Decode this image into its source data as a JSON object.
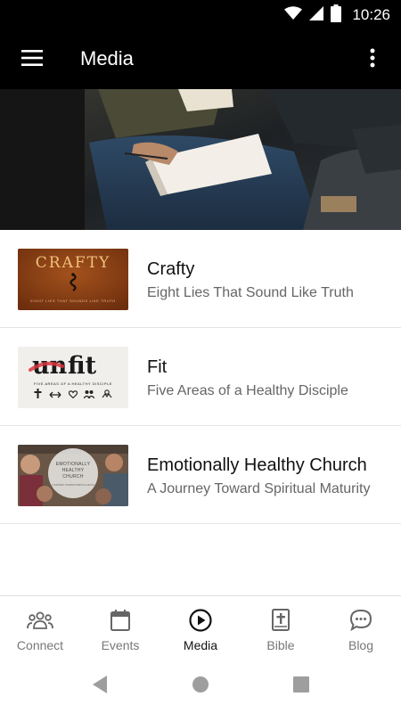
{
  "status_bar": {
    "time": "10:26",
    "icons": [
      "wifi-icon",
      "cellular-signal-icon",
      "battery-icon"
    ]
  },
  "app_bar": {
    "title": "Media",
    "left_icon": "menu-icon",
    "right_icon": "more-vert-icon"
  },
  "hero": {
    "image": "people-with-notebooks-photo"
  },
  "media_list": {
    "items": [
      {
        "title": "Crafty",
        "subtitle": "Eight Lies That Sound Like Truth",
        "thumb": {
          "word": "CRAFTY",
          "tagline": "EIGHT LIES THAT SOUNDS LIKE TRUTH",
          "icon": "snake-icon",
          "bg": "#8b3f14"
        }
      },
      {
        "title": "Fit",
        "subtitle": "Five Areas of a Healthy Disciple",
        "thumb": {
          "prefix": "un",
          "word": "fit",
          "tagline": "FIVE AREAS OF A HEALTHY DISCIPLE",
          "accent": "#d9363e"
        }
      },
      {
        "title": "Emotionally Healthy Church",
        "subtitle": "A Journey Toward Spiritual Maturity",
        "thumb": {
          "line1": "EMOTIONALLY",
          "line2": "HEALTHY",
          "line3": "CHURCH",
          "tagline": "A JOURNEY TOWARD SPIRITUAL MATURITY"
        }
      }
    ]
  },
  "bottom_nav": {
    "active": "Media",
    "items": [
      {
        "label": "Connect",
        "icon": "group-icon"
      },
      {
        "label": "Events",
        "icon": "calendar-icon"
      },
      {
        "label": "Media",
        "icon": "play-circle-icon"
      },
      {
        "label": "Bible",
        "icon": "bible-icon"
      },
      {
        "label": "Blog",
        "icon": "chat-bubble-icon"
      }
    ]
  },
  "system_nav": {
    "icons": [
      "back-icon",
      "home-icon",
      "recents-icon"
    ]
  }
}
